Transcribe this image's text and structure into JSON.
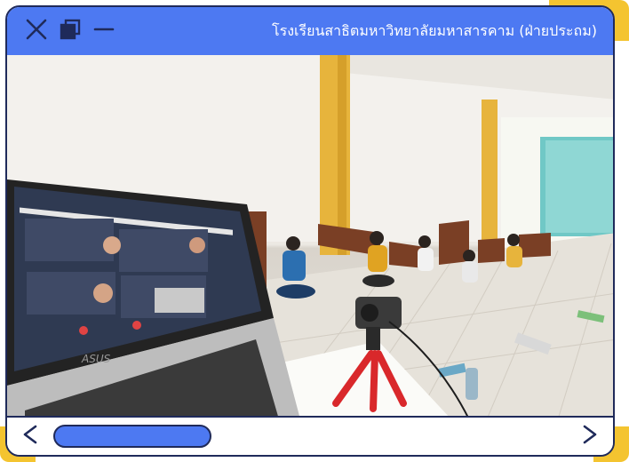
{
  "window": {
    "title": "โรงเรียนสาธิตมหาวิทยาลัยมหาสารคาม (ฝ่ายประถม)",
    "controls": [
      "close-icon",
      "maximize-icon",
      "minimize-icon"
    ]
  },
  "photo": {
    "laptop_brand": "ASUS"
  },
  "navigation": {
    "prev_icon": "chevron-left-icon",
    "next_icon": "chevron-right-icon",
    "scroll_position": 0
  },
  "colors": {
    "accent": "#4d79f2",
    "outline": "#1f2a5a",
    "corner": "#f4c430"
  }
}
